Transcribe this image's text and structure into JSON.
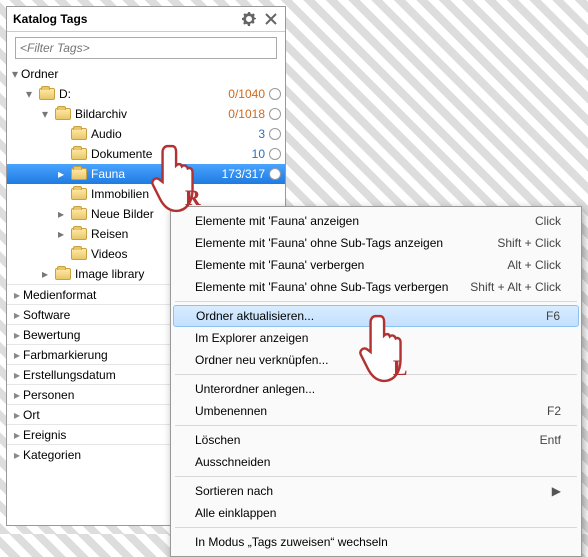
{
  "panel": {
    "title": "Katalog Tags",
    "filter_placeholder": "<Filter Tags>"
  },
  "tree": {
    "root": {
      "label": "Ordner"
    },
    "d": {
      "label": "D:",
      "count": "0/1040"
    },
    "bildarchiv": {
      "label": "Bildarchiv",
      "count": "0/1018"
    },
    "audio": {
      "label": "Audio",
      "count": "3"
    },
    "dokumente": {
      "label": "Dokumente",
      "count": "10"
    },
    "fauna": {
      "label": "Fauna",
      "count": "173/317"
    },
    "immobilien": {
      "label": "Immobilien"
    },
    "neuebilder": {
      "label": "Neue Bilder"
    },
    "reisen": {
      "label": "Reisen"
    },
    "videos": {
      "label": "Videos"
    },
    "imagelib": {
      "label": "Image library"
    }
  },
  "categories": {
    "medienformat": "Medienformat",
    "software": "Software",
    "bewertung": "Bewertung",
    "farbmarkierung": "Farbmarkierung",
    "erstellungsdatum": "Erstellungsdatum",
    "personen": "Personen",
    "ort": "Ort",
    "ereignis": "Ereignis",
    "kategorien": "Kategorien"
  },
  "context": {
    "show": {
      "label": "Elemente mit 'Fauna' anzeigen",
      "short": "Click"
    },
    "showNoSub": {
      "label": "Elemente mit 'Fauna' ohne Sub-Tags anzeigen",
      "short": "Shift + Click"
    },
    "hide": {
      "label": "Elemente mit 'Fauna' verbergen",
      "short": "Alt + Click"
    },
    "hideNoSub": {
      "label": "Elemente mit 'Fauna' ohne Sub-Tags verbergen",
      "short": "Shift + Alt + Click"
    },
    "refresh": {
      "label": "Ordner aktualisieren...",
      "short": "F6"
    },
    "explorer": {
      "label": "Im Explorer anzeigen"
    },
    "relink": {
      "label": "Ordner neu verknüpfen..."
    },
    "newsub": {
      "label": "Unterordner anlegen..."
    },
    "rename": {
      "label": "Umbenennen",
      "short": "F2"
    },
    "delete": {
      "label": "Löschen",
      "short": "Entf"
    },
    "cut": {
      "label": "Ausschneiden"
    },
    "sort": {
      "label": "Sortieren nach"
    },
    "collapse": {
      "label": "Alle einklappen"
    },
    "assignmode": {
      "label": "In Modus „Tags zuweisen“ wechseln"
    }
  },
  "hands": {
    "right": "R",
    "left": "L"
  }
}
